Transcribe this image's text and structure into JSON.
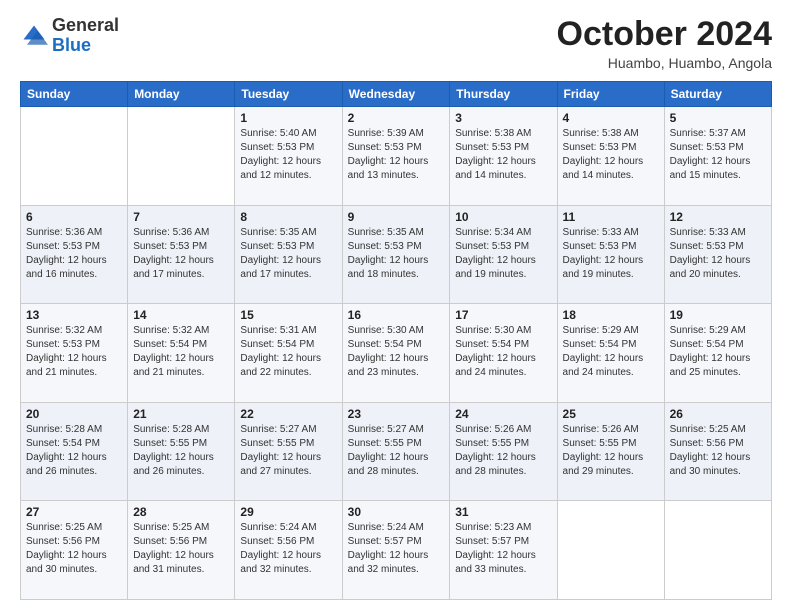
{
  "logo": {
    "general": "General",
    "blue": "Blue"
  },
  "header": {
    "month_title": "October 2024",
    "location": "Huambo, Huambo, Angola"
  },
  "days_of_week": [
    "Sunday",
    "Monday",
    "Tuesday",
    "Wednesday",
    "Thursday",
    "Friday",
    "Saturday"
  ],
  "weeks": [
    [
      {
        "day": "",
        "info": ""
      },
      {
        "day": "",
        "info": ""
      },
      {
        "day": "1",
        "info": "Sunrise: 5:40 AM\nSunset: 5:53 PM\nDaylight: 12 hours\nand 12 minutes."
      },
      {
        "day": "2",
        "info": "Sunrise: 5:39 AM\nSunset: 5:53 PM\nDaylight: 12 hours\nand 13 minutes."
      },
      {
        "day": "3",
        "info": "Sunrise: 5:38 AM\nSunset: 5:53 PM\nDaylight: 12 hours\nand 14 minutes."
      },
      {
        "day": "4",
        "info": "Sunrise: 5:38 AM\nSunset: 5:53 PM\nDaylight: 12 hours\nand 14 minutes."
      },
      {
        "day": "5",
        "info": "Sunrise: 5:37 AM\nSunset: 5:53 PM\nDaylight: 12 hours\nand 15 minutes."
      }
    ],
    [
      {
        "day": "6",
        "info": "Sunrise: 5:36 AM\nSunset: 5:53 PM\nDaylight: 12 hours\nand 16 minutes."
      },
      {
        "day": "7",
        "info": "Sunrise: 5:36 AM\nSunset: 5:53 PM\nDaylight: 12 hours\nand 17 minutes."
      },
      {
        "day": "8",
        "info": "Sunrise: 5:35 AM\nSunset: 5:53 PM\nDaylight: 12 hours\nand 17 minutes."
      },
      {
        "day": "9",
        "info": "Sunrise: 5:35 AM\nSunset: 5:53 PM\nDaylight: 12 hours\nand 18 minutes."
      },
      {
        "day": "10",
        "info": "Sunrise: 5:34 AM\nSunset: 5:53 PM\nDaylight: 12 hours\nand 19 minutes."
      },
      {
        "day": "11",
        "info": "Sunrise: 5:33 AM\nSunset: 5:53 PM\nDaylight: 12 hours\nand 19 minutes."
      },
      {
        "day": "12",
        "info": "Sunrise: 5:33 AM\nSunset: 5:53 PM\nDaylight: 12 hours\nand 20 minutes."
      }
    ],
    [
      {
        "day": "13",
        "info": "Sunrise: 5:32 AM\nSunset: 5:53 PM\nDaylight: 12 hours\nand 21 minutes."
      },
      {
        "day": "14",
        "info": "Sunrise: 5:32 AM\nSunset: 5:54 PM\nDaylight: 12 hours\nand 21 minutes."
      },
      {
        "day": "15",
        "info": "Sunrise: 5:31 AM\nSunset: 5:54 PM\nDaylight: 12 hours\nand 22 minutes."
      },
      {
        "day": "16",
        "info": "Sunrise: 5:30 AM\nSunset: 5:54 PM\nDaylight: 12 hours\nand 23 minutes."
      },
      {
        "day": "17",
        "info": "Sunrise: 5:30 AM\nSunset: 5:54 PM\nDaylight: 12 hours\nand 24 minutes."
      },
      {
        "day": "18",
        "info": "Sunrise: 5:29 AM\nSunset: 5:54 PM\nDaylight: 12 hours\nand 24 minutes."
      },
      {
        "day": "19",
        "info": "Sunrise: 5:29 AM\nSunset: 5:54 PM\nDaylight: 12 hours\nand 25 minutes."
      }
    ],
    [
      {
        "day": "20",
        "info": "Sunrise: 5:28 AM\nSunset: 5:54 PM\nDaylight: 12 hours\nand 26 minutes."
      },
      {
        "day": "21",
        "info": "Sunrise: 5:28 AM\nSunset: 5:55 PM\nDaylight: 12 hours\nand 26 minutes."
      },
      {
        "day": "22",
        "info": "Sunrise: 5:27 AM\nSunset: 5:55 PM\nDaylight: 12 hours\nand 27 minutes."
      },
      {
        "day": "23",
        "info": "Sunrise: 5:27 AM\nSunset: 5:55 PM\nDaylight: 12 hours\nand 28 minutes."
      },
      {
        "day": "24",
        "info": "Sunrise: 5:26 AM\nSunset: 5:55 PM\nDaylight: 12 hours\nand 28 minutes."
      },
      {
        "day": "25",
        "info": "Sunrise: 5:26 AM\nSunset: 5:55 PM\nDaylight: 12 hours\nand 29 minutes."
      },
      {
        "day": "26",
        "info": "Sunrise: 5:25 AM\nSunset: 5:56 PM\nDaylight: 12 hours\nand 30 minutes."
      }
    ],
    [
      {
        "day": "27",
        "info": "Sunrise: 5:25 AM\nSunset: 5:56 PM\nDaylight: 12 hours\nand 30 minutes."
      },
      {
        "day": "28",
        "info": "Sunrise: 5:25 AM\nSunset: 5:56 PM\nDaylight: 12 hours\nand 31 minutes."
      },
      {
        "day": "29",
        "info": "Sunrise: 5:24 AM\nSunset: 5:56 PM\nDaylight: 12 hours\nand 32 minutes."
      },
      {
        "day": "30",
        "info": "Sunrise: 5:24 AM\nSunset: 5:57 PM\nDaylight: 12 hours\nand 32 minutes."
      },
      {
        "day": "31",
        "info": "Sunrise: 5:23 AM\nSunset: 5:57 PM\nDaylight: 12 hours\nand 33 minutes."
      },
      {
        "day": "",
        "info": ""
      },
      {
        "day": "",
        "info": ""
      }
    ]
  ]
}
